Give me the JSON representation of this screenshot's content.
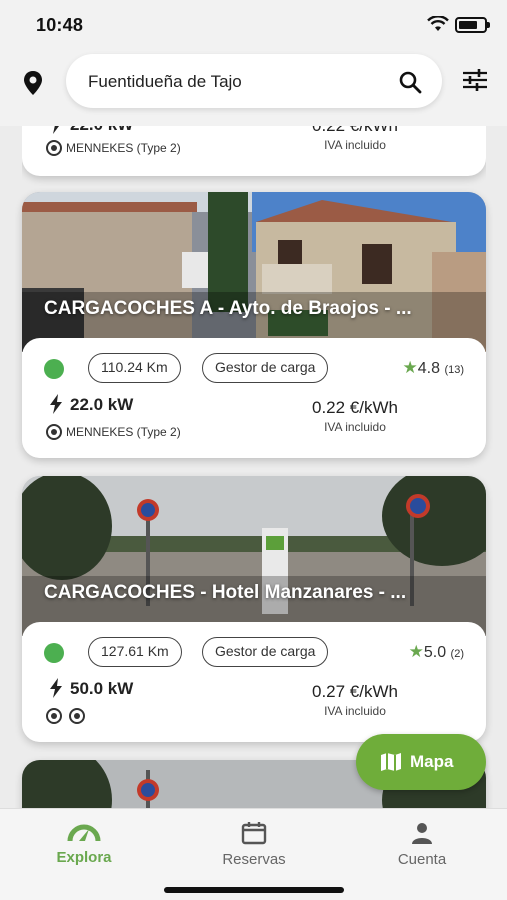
{
  "status_bar": {
    "time": "10:48"
  },
  "search": {
    "query": "Fuentidueña de Tajo"
  },
  "stations": [
    {
      "name": "",
      "power": "22.0 kW",
      "price": "0.22 €/kWh",
      "tax_note": "IVA incluido",
      "connector": "MENNEKES (Type 2)"
    },
    {
      "name": "CARGACOCHES A - Ayto. de Braojos - ...",
      "distance": "110.24 Km",
      "operator": "Gestor de carga",
      "rating": "4.8",
      "rating_count": "(13)",
      "power": "22.0 kW",
      "price": "0.22 €/kWh",
      "tax_note": "IVA incluido",
      "connector": "MENNEKES (Type 2)",
      "status_color": "#4caf50"
    },
    {
      "name": "CARGACOCHES - Hotel Manzanares - ...",
      "distance": "127.61 Km",
      "operator": "Gestor de carga",
      "rating": "5.0",
      "rating_count": "(2)",
      "power": "50.0 kW",
      "price": "0.27 €/kWh",
      "tax_note": "IVA incluido",
      "status_color": "#4caf50"
    }
  ],
  "map_button": {
    "label": "Mapa"
  },
  "tabs": [
    {
      "label": "Explora",
      "icon": "explore-icon",
      "active": true
    },
    {
      "label": "Reservas",
      "icon": "calendar-icon",
      "active": false
    },
    {
      "label": "Cuenta",
      "icon": "user-icon",
      "active": false
    }
  ],
  "colors": {
    "accent": "#6aa84f",
    "available": "#4caf50"
  }
}
